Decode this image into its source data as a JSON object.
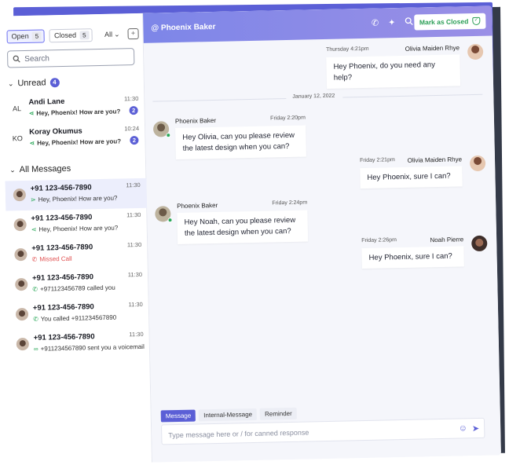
{
  "sidebar": {
    "filters": [
      {
        "label": "Open",
        "count": "5"
      },
      {
        "label": "Closed",
        "count": "5"
      }
    ],
    "filter_all": "All",
    "search_placeholder": "Search",
    "unread_section": {
      "label": "Unread",
      "count": "4"
    },
    "unread": [
      {
        "initials": "AL",
        "name": "Andi Lane",
        "preview": "Hey, Phoenix! How are you?",
        "time": "11:30",
        "count": "2"
      },
      {
        "initials": "KO",
        "name": "Koray Okumus",
        "preview": "Hey, Phoenix! How are you?",
        "time": "10:24",
        "count": "2"
      }
    ],
    "all_section": {
      "label": "All Messages"
    },
    "all": [
      {
        "name": "+91 123-456-7890",
        "preview": "Hey, Phoenix! How are you?",
        "time": "11:30",
        "icon": "sent-icon"
      },
      {
        "name": "+91 123-456-7890",
        "preview": "Hey, Phoenix! How are you?",
        "time": "11:30",
        "icon": "received-icon"
      },
      {
        "name": "+91 123-456-7890",
        "preview": "Missed Call",
        "time": "11:30",
        "icon": "missed-call-icon"
      },
      {
        "name": "+91 123-456-7890",
        "preview": "+971123456789 called you",
        "time": "11:30",
        "icon": "incoming-call-icon"
      },
      {
        "name": "+91 123-456-7890",
        "preview": "You called +911234567890",
        "time": "11:30",
        "icon": "outgoing-call-icon"
      },
      {
        "name": "+91 123-456-7890",
        "preview": "+911234567890 sent you a voicemail",
        "time": "11:30",
        "icon": "voicemail-icon"
      }
    ]
  },
  "chat": {
    "title": "@ Phoenix Baker",
    "mark_closed_label": "Mark as Closed",
    "date_separator": "January 12, 2022",
    "messages": [
      {
        "sender": "Olivia Maiden Rhye",
        "time": "Thursday 4:21pm",
        "text": "Hey Phoenix, do you need any help?",
        "side": "right"
      },
      {
        "sender": "Phoenix Baker",
        "time": "Friday 2:20pm",
        "text": "Hey Olivia, can you please review the latest design when you can?",
        "side": "left"
      },
      {
        "sender": "Olivia Maiden Rhye",
        "time": "Friday 2:21pm",
        "text": "Hey Phoenix, sure I can?",
        "side": "right"
      },
      {
        "sender": "Phoenix Baker",
        "time": "Friday 2:24pm",
        "text": "Hey Noah, can you please review the latest design when you can?",
        "side": "left"
      },
      {
        "sender": "Noah Pierre",
        "time": "Friday 2:26pm",
        "text": "Hey Phoenix, sure I can?",
        "side": "right"
      }
    ],
    "composer": {
      "tabs": [
        "Message",
        "Internal-Message",
        "Reminder"
      ],
      "placeholder": "Type message here or / for canned response"
    }
  },
  "colors": {
    "accent": "#5b5fd6",
    "header_start": "#7d86e8",
    "header_end": "#9a8fe6",
    "success": "#2a9e55",
    "danger": "#e05050"
  }
}
